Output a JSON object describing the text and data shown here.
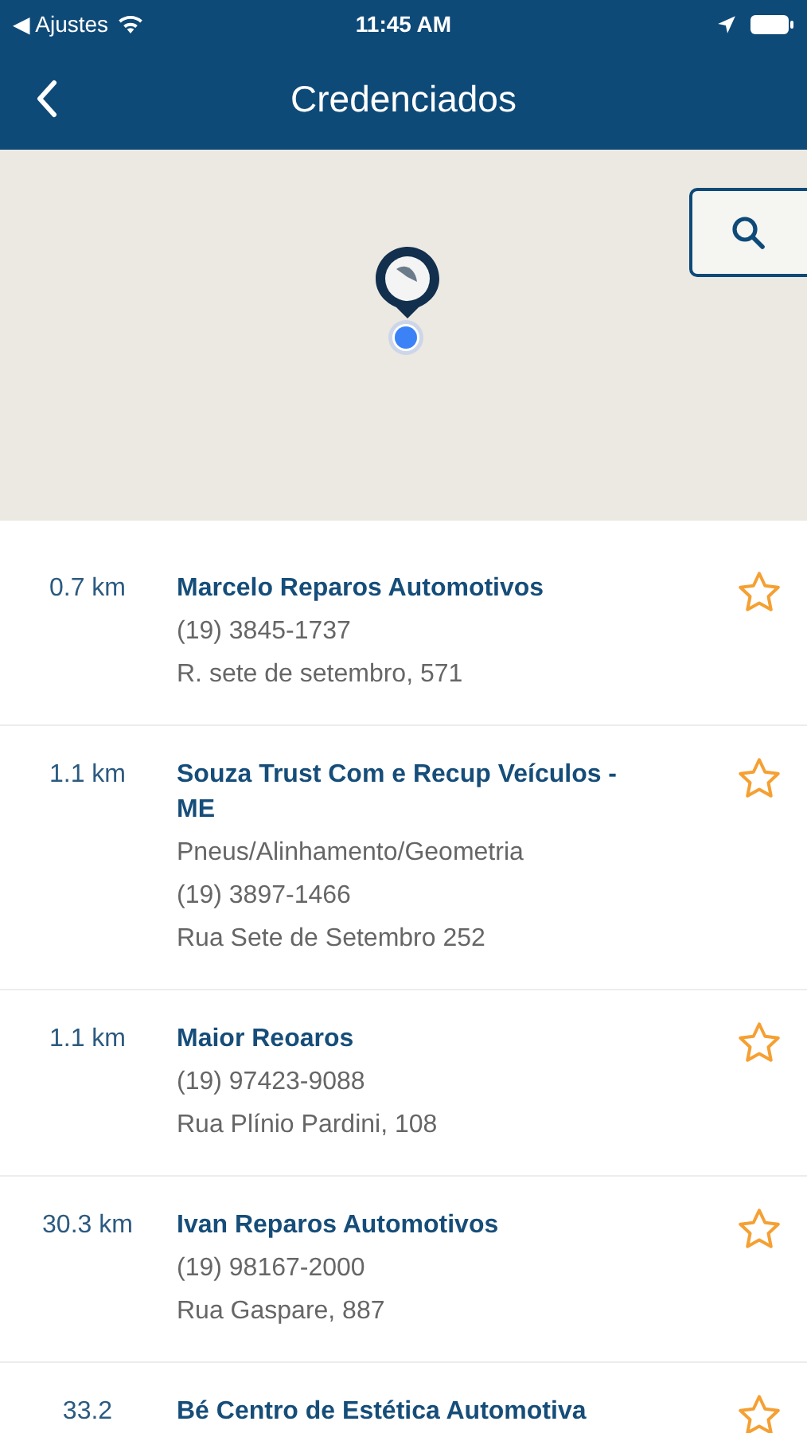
{
  "status_bar": {
    "back_label": "◀ Ajustes",
    "time": "11:45 AM"
  },
  "nav": {
    "title": "Credenciados"
  },
  "places": [
    {
      "distance": "0.7 km",
      "name": "Marcelo Reparos Automotivos",
      "lines": [
        "(19) 3845-1737",
        "R. sete de setembro, 571"
      ],
      "favorite": false
    },
    {
      "distance": "1.1 km",
      "name": "Souza Trust Com e Recup Veículos - ME",
      "lines": [
        "Pneus/Alinhamento/Geometria",
        "(19) 3897-1466",
        "Rua Sete de Setembro 252"
      ],
      "favorite": false
    },
    {
      "distance": "1.1 km",
      "name": "Maior Reoaros",
      "lines": [
        "(19) 97423-9088",
        "Rua Plínio Pardini, 108"
      ],
      "favorite": false
    },
    {
      "distance": "30.3 km",
      "name": "Ivan Reparos Automotivos",
      "lines": [
        "(19) 98167-2000",
        "Rua Gaspare, 887"
      ],
      "favorite": false
    },
    {
      "distance": "33.2",
      "name": "Bé Centro de Estética Automotiva",
      "favorite": false
    }
  ]
}
